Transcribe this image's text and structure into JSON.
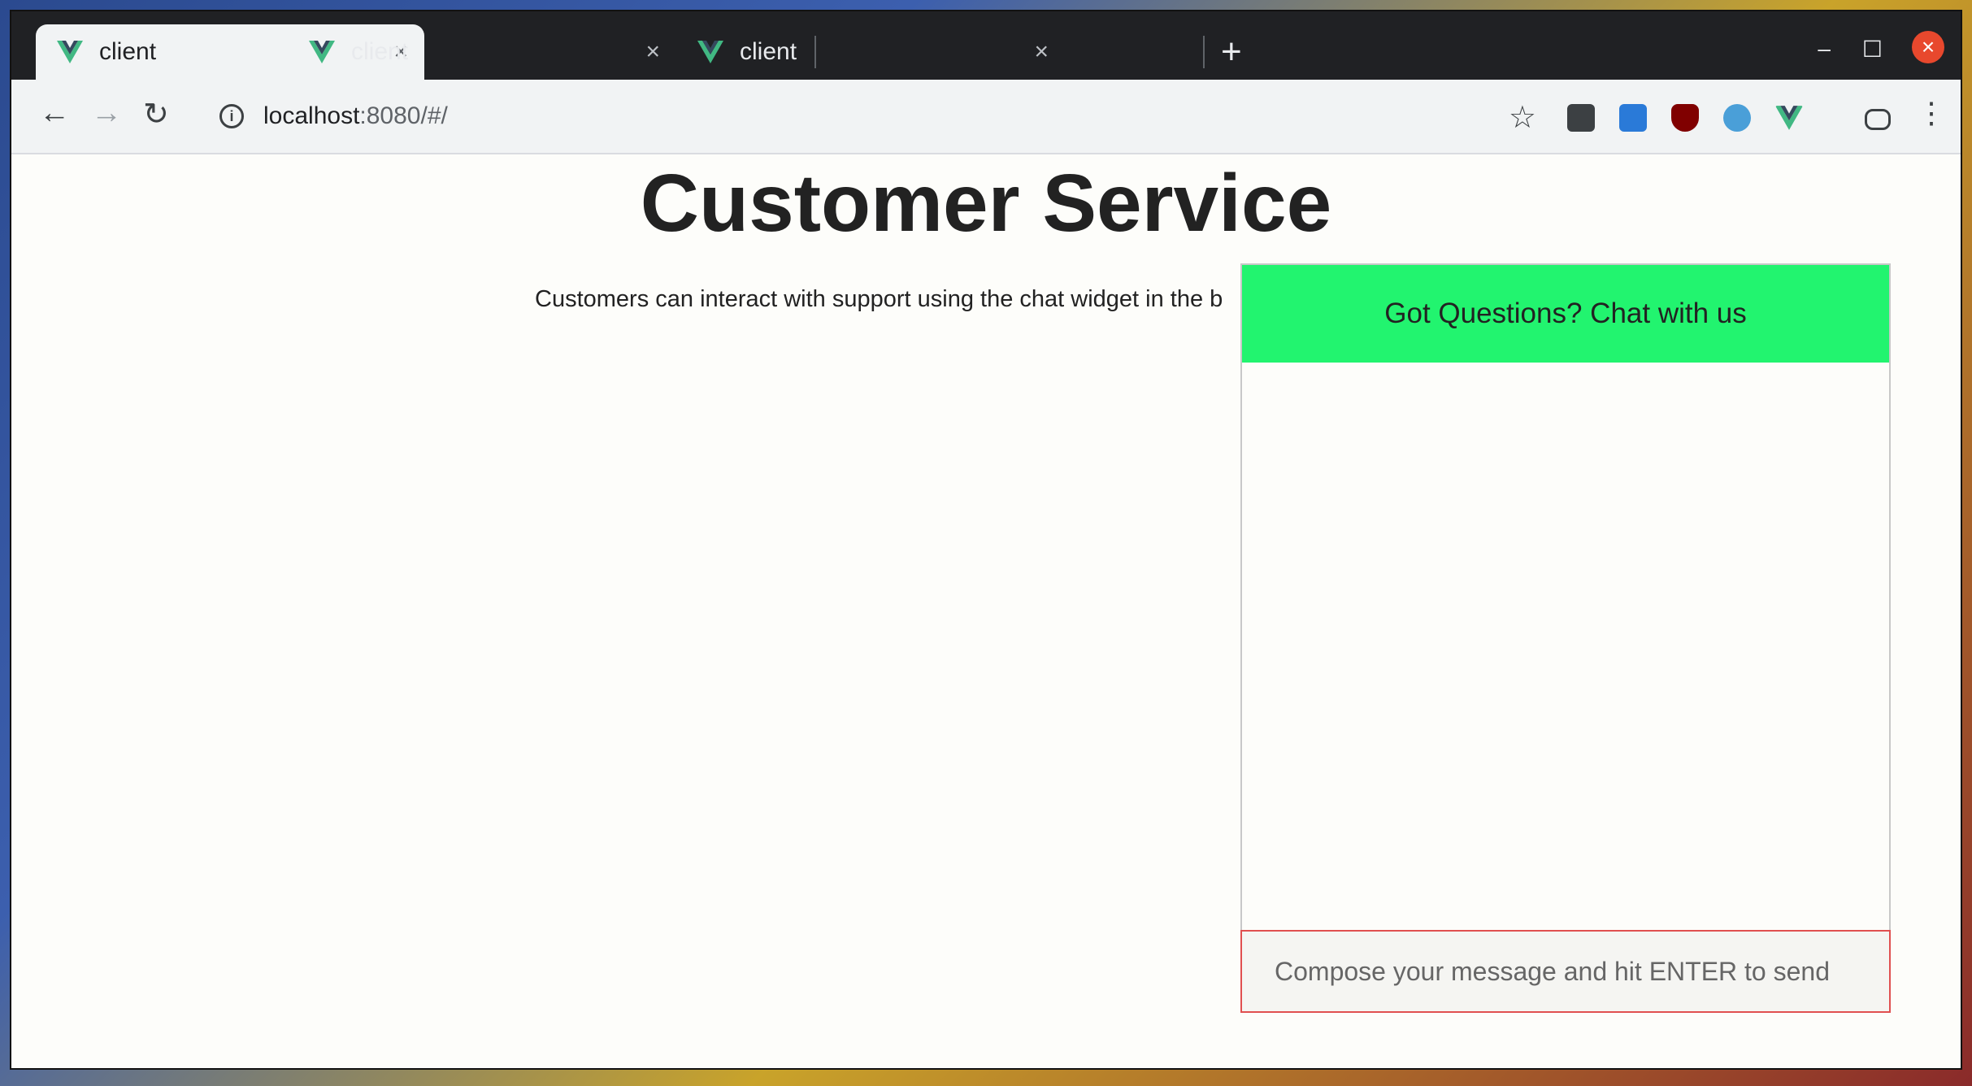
{
  "browser": {
    "tabs": [
      {
        "label": "client",
        "close": "×"
      },
      {
        "label": "client",
        "close": "×"
      },
      {
        "label": "client",
        "close": "×"
      }
    ],
    "new_tab": "+",
    "window_controls": {
      "minimize": "–",
      "maximize": "☐",
      "close": "×"
    },
    "nav": {
      "back": "←",
      "forward": "→",
      "reload": "↻"
    },
    "url": {
      "host": "localhost",
      "rest": ":8080/#/"
    },
    "bookmark_star": "☆",
    "menu": "⋮"
  },
  "page": {
    "title": "Customer Service",
    "intro": "Customers can interact with support using the chat widget in the b"
  },
  "chat": {
    "header": "Got Questions? Chat with us",
    "input_value": "",
    "input_placeholder": "Compose your message and hit ENTER to send"
  },
  "colors": {
    "chat_header": "#22f46f",
    "input_border": "#e05050",
    "vue_green": "#41b883"
  }
}
